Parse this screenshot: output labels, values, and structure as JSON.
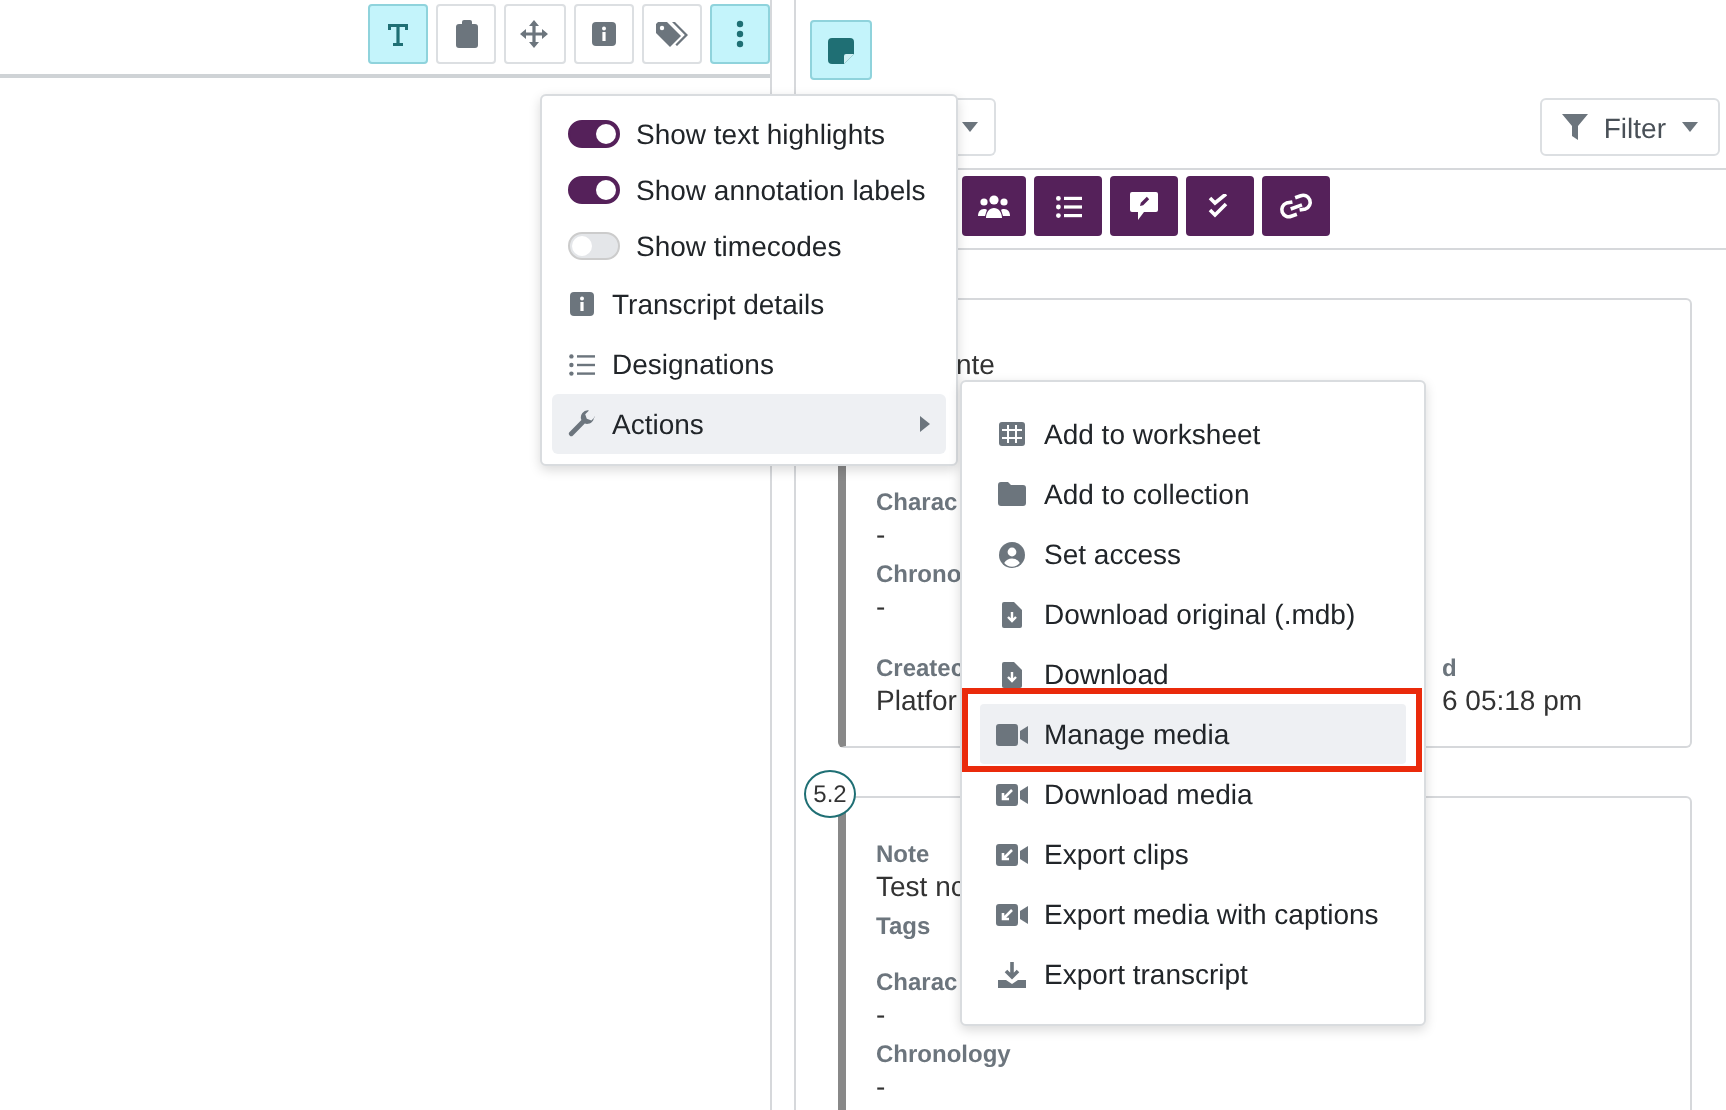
{
  "left_toolbar": [
    {
      "active": true
    },
    {
      "active": false
    },
    {
      "active": false
    },
    {
      "active": false
    },
    {
      "active": false
    },
    {
      "active": true
    }
  ],
  "view_menu": [
    {
      "kind": "toggle",
      "label": "Show text highlights",
      "on": true,
      "highlighted": false
    },
    {
      "kind": "toggle",
      "label": "Show annotation labels",
      "on": true,
      "highlighted": false
    },
    {
      "kind": "toggle",
      "label": "Show timecodes",
      "on": false,
      "highlighted": false
    },
    {
      "kind": "item",
      "label": "Transcript details",
      "highlighted": false
    },
    {
      "kind": "item",
      "label": "Designations",
      "highlighted": false
    },
    {
      "kind": "submenu",
      "label": "Actions",
      "highlighted": true
    }
  ],
  "actions_menu": [
    {
      "label": "Add to worksheet",
      "highlighted": false,
      "framed": false
    },
    {
      "label": "Add to collection",
      "highlighted": false,
      "framed": false
    },
    {
      "label": "Set access",
      "highlighted": false,
      "framed": false
    },
    {
      "label": "Download original (.mdb)",
      "highlighted": false,
      "framed": false
    },
    {
      "label": "Download",
      "highlighted": false,
      "framed": false
    },
    {
      "label": "Manage media",
      "highlighted": true,
      "framed": true
    },
    {
      "label": "Download media",
      "highlighted": false,
      "framed": false
    },
    {
      "label": "Export clips",
      "highlighted": false,
      "framed": false
    },
    {
      "label": "Export media with captions",
      "highlighted": false,
      "framed": false
    },
    {
      "label": "Export transcript",
      "highlighted": false,
      "framed": false
    }
  ],
  "side_button": {
    "active": true
  },
  "filter": {
    "label": "Filter"
  },
  "cards": [
    {
      "lines": [
        {
          "kind": "value",
          "text": "nte"
        },
        {
          "kind": "label",
          "text": "Charac"
        },
        {
          "kind": "value",
          "text": "-"
        },
        {
          "kind": "label",
          "text": "Chrono"
        },
        {
          "kind": "value",
          "text": "-"
        },
        {
          "kind": "label",
          "text": "Createc",
          "aside": "d"
        },
        {
          "kind": "value",
          "text": "Platfor",
          "aside": "6 05:18 pm"
        }
      ]
    },
    {
      "badge": "5.2",
      "lines": [
        {
          "kind": "label",
          "text": "Note"
        },
        {
          "kind": "value",
          "text": "Test nc"
        },
        {
          "kind": "label",
          "text": "Tags"
        },
        {
          "kind": "label",
          "text": "Charac"
        },
        {
          "kind": "value",
          "text": "-"
        },
        {
          "kind": "label",
          "text": "Chronology"
        },
        {
          "kind": "value",
          "text": "-"
        }
      ]
    }
  ]
}
